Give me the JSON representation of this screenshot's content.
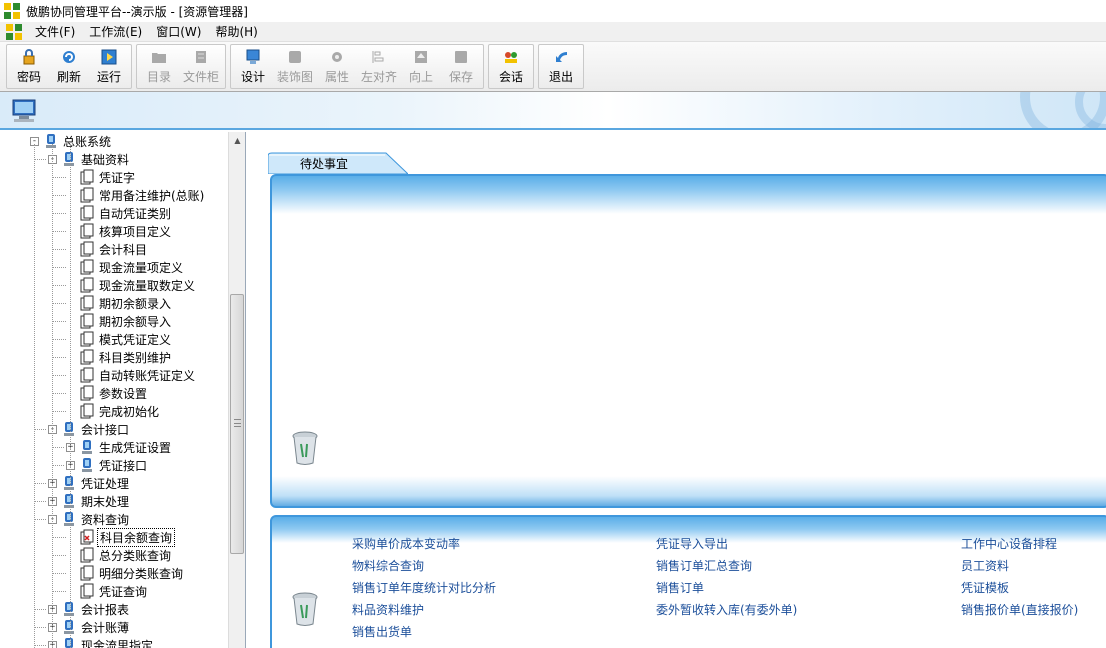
{
  "window": {
    "title": "傲鹏协同管理平台--演示版 - [资源管理器]"
  },
  "menu": {
    "items": [
      "文件(F)",
      "工作流(E)",
      "窗口(W)",
      "帮助(H)"
    ]
  },
  "toolbar": {
    "buttons": [
      {
        "label": "密码",
        "icon": "lock-icon",
        "enabled": true
      },
      {
        "label": "刷新",
        "icon": "refresh-icon",
        "enabled": true
      },
      {
        "label": "运行",
        "icon": "run-icon",
        "enabled": true
      },
      {
        "label": "目录",
        "icon": "folder-icon",
        "enabled": false
      },
      {
        "label": "文件柜",
        "icon": "cabinet-icon",
        "enabled": false
      },
      {
        "label": "设计",
        "icon": "monitor-icon",
        "enabled": true
      },
      {
        "label": "装饰图",
        "icon": "picture-icon",
        "enabled": false
      },
      {
        "label": "属性",
        "icon": "gear-icon",
        "enabled": false
      },
      {
        "label": "左对齐",
        "icon": "align-left-icon",
        "enabled": false
      },
      {
        "label": "向上",
        "icon": "up-icon",
        "enabled": false
      },
      {
        "label": "保存",
        "icon": "save-icon",
        "enabled": false
      },
      {
        "label": "会话",
        "icon": "chat-icon",
        "enabled": true
      },
      {
        "label": "退出",
        "icon": "exit-icon",
        "enabled": true
      }
    ]
  },
  "tree": {
    "nodes": [
      {
        "label": "总账系统",
        "level": 0,
        "toggle": "-",
        "type": "module"
      },
      {
        "label": "基础资料",
        "level": 1,
        "toggle": "-",
        "type": "module"
      },
      {
        "label": "凭证字",
        "level": 2,
        "type": "doc"
      },
      {
        "label": "常用备注维护(总账)",
        "level": 2,
        "type": "doc"
      },
      {
        "label": "自动凭证类别",
        "level": 2,
        "type": "doc"
      },
      {
        "label": "核算项目定义",
        "level": 2,
        "type": "doc"
      },
      {
        "label": "会计科目",
        "level": 2,
        "type": "doc"
      },
      {
        "label": "现金流量项定义",
        "level": 2,
        "type": "doc"
      },
      {
        "label": "现金流量取数定义",
        "level": 2,
        "type": "doc"
      },
      {
        "label": "期初余额录入",
        "level": 2,
        "type": "doc"
      },
      {
        "label": "期初余额导入",
        "level": 2,
        "type": "doc"
      },
      {
        "label": "模式凭证定义",
        "level": 2,
        "type": "doc"
      },
      {
        "label": "科目类别维护",
        "level": 2,
        "type": "doc"
      },
      {
        "label": "自动转账凭证定义",
        "level": 2,
        "type": "doc"
      },
      {
        "label": "参数设置",
        "level": 2,
        "type": "doc"
      },
      {
        "label": "完成初始化",
        "level": 2,
        "type": "doc"
      },
      {
        "label": "会计接口",
        "level": 1,
        "toggle": "-",
        "type": "module"
      },
      {
        "label": "生成凭证设置",
        "level": 2,
        "toggle": "+",
        "type": "module"
      },
      {
        "label": "凭证接口",
        "level": 2,
        "toggle": "+",
        "type": "module"
      },
      {
        "label": "凭证处理",
        "level": 1,
        "toggle": "+",
        "type": "module"
      },
      {
        "label": "期末处理",
        "level": 1,
        "toggle": "+",
        "type": "module"
      },
      {
        "label": "资料查询",
        "level": 1,
        "toggle": "-",
        "type": "module"
      },
      {
        "label": "科目余额查询",
        "level": 2,
        "type": "doc-red",
        "selected": true
      },
      {
        "label": "总分类账查询",
        "level": 2,
        "type": "doc"
      },
      {
        "label": "明细分类账查询",
        "level": 2,
        "type": "doc"
      },
      {
        "label": "凭证查询",
        "level": 2,
        "type": "doc"
      },
      {
        "label": "会计报表",
        "level": 1,
        "toggle": "+",
        "type": "module"
      },
      {
        "label": "会计账薄",
        "level": 1,
        "toggle": "+",
        "type": "module"
      },
      {
        "label": "现金流里指定",
        "level": 1,
        "toggle": "+",
        "type": "module"
      }
    ]
  },
  "main": {
    "tab_label": "待处事宜",
    "links": [
      {
        "label": "采购单价成本变动率",
        "col": 0,
        "row": 0
      },
      {
        "label": "物料综合查询",
        "col": 0,
        "row": 1
      },
      {
        "label": "销售订单年度统计对比分析",
        "col": 0,
        "row": 2
      },
      {
        "label": "料品资料维护",
        "col": 0,
        "row": 3
      },
      {
        "label": "销售出货单",
        "col": 0,
        "row": 4
      },
      {
        "label": "凭证导入导出",
        "col": 1,
        "row": 0
      },
      {
        "label": "销售订单汇总查询",
        "col": 1,
        "row": 1
      },
      {
        "label": "销售订单",
        "col": 1,
        "row": 2
      },
      {
        "label": "委外暂收转入库(有委外单)",
        "col": 1,
        "row": 3
      },
      {
        "label": "工作中心设备排程",
        "col": 2,
        "row": 0
      },
      {
        "label": "员工资料",
        "col": 2,
        "row": 1
      },
      {
        "label": "凭证模板",
        "col": 2,
        "row": 2
      },
      {
        "label": "销售报价单(直接报价)",
        "col": 2,
        "row": 3
      }
    ]
  },
  "colors": {
    "accent": "#3f97dc",
    "link": "#1c4f9a",
    "module_icon": "#2f6fc0"
  }
}
